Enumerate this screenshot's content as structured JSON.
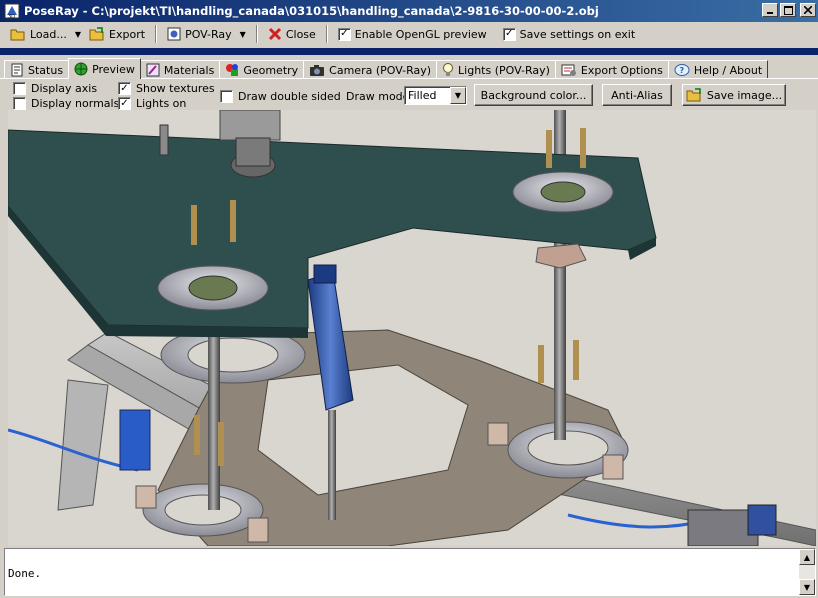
{
  "window": {
    "title": "PoseRay - C:\\projekt\\TI\\handling_canada\\031015\\handling_canada\\2-9816-30-00-00-2.obj"
  },
  "toolbar": {
    "load_label": "Load...",
    "export_label": "Export",
    "povray_label": "POV-Ray",
    "close_label": "Close",
    "opengl_label": "Enable OpenGL preview",
    "opengl_checked": true,
    "save_settings_label": "Save settings on exit",
    "save_settings_checked": true
  },
  "tabs": [
    {
      "label": "Status",
      "icon": "status-icon"
    },
    {
      "label": "Preview",
      "icon": "preview-icon",
      "active": true
    },
    {
      "label": "Materials",
      "icon": "materials-icon"
    },
    {
      "label": "Geometry",
      "icon": "geometry-icon"
    },
    {
      "label": "Camera (POV-Ray)",
      "icon": "camera-icon"
    },
    {
      "label": "Lights (POV-Ray)",
      "icon": "lightbulb-icon"
    },
    {
      "label": "Export Options",
      "icon": "export-options-icon"
    },
    {
      "label": "Help / About",
      "icon": "help-icon"
    }
  ],
  "options": {
    "display_axis": {
      "label": "Display axis",
      "checked": false
    },
    "display_normals": {
      "label": "Display normals",
      "checked": false
    },
    "show_textures": {
      "label": "Show textures",
      "checked": true
    },
    "lights_on": {
      "label": "Lights on",
      "checked": true
    },
    "double_sided": {
      "label": "Draw double sided",
      "checked": false
    },
    "draw_mode_label": "Draw mode:",
    "draw_mode_value": "Filled",
    "background_color_label": "Background color...",
    "anti_alias_label": "Anti-Alias",
    "save_image_label": "Save image..."
  },
  "console": {
    "text": "Done."
  },
  "colors": {
    "titlebar": "#0a246a",
    "plate_top": "#2f4f4f",
    "frame": "#8e8478",
    "rail": "#9a9a9a",
    "cylinder": "#3b62b0",
    "cable": "#2060d0"
  }
}
